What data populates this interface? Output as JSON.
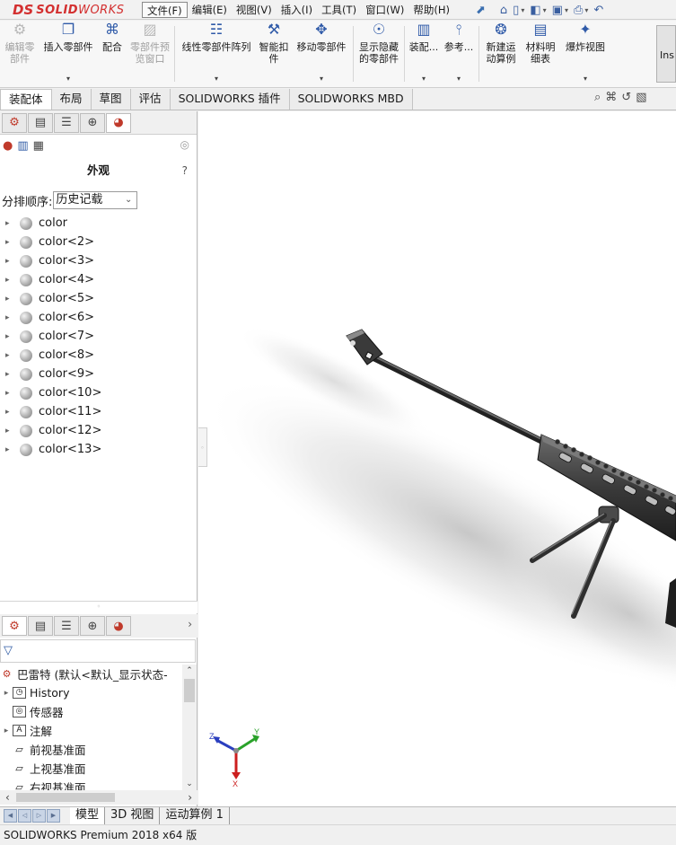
{
  "app": {
    "logo_ds": "DS",
    "logo_solid": "SOLID",
    "logo_works": "WORKS",
    "status_text": "SOLIDWORKS Premium 2018 x64 版"
  },
  "menu": [
    "文件(F)",
    "编辑(E)",
    "视图(V)",
    "插入(I)",
    "工具(T)",
    "窗口(W)",
    "帮助(H)"
  ],
  "commands": {
    "edit_part": "编辑零部件",
    "insert_part": "插入零部件",
    "mate": "配合",
    "preview_window": "零部件预览窗口",
    "linear_pattern": "线性零部件阵列",
    "smart_fastener": "智能扣件",
    "move_part": "移动零部件",
    "show_hidden": "显示隐藏的零部件",
    "assembly": "装配...",
    "reference": "参考...",
    "new_motion": "新建运动算例",
    "bom": "材料明细表",
    "explode": "爆炸视图",
    "instant3d": "Ins"
  },
  "tabs": [
    "装配体",
    "布局",
    "草图",
    "评估",
    "SOLIDWORKS 插件",
    "SOLIDWORKS MBD"
  ],
  "appearance_panel": {
    "title": "外观",
    "help": "?",
    "sort_label": "分排顺序:",
    "sort_value": "历史记载",
    "colors": [
      "color",
      "color<2>",
      "color<3>",
      "color<4>",
      "color<5>",
      "color<6>",
      "color<7>",
      "color<8>",
      "color<9>",
      "color<10>",
      "color<11>",
      "color<12>",
      "color<13>"
    ]
  },
  "feature_tree": {
    "root": "巴雷特 (默认<默认_显示状态-",
    "items": [
      {
        "label": "History",
        "expand": true
      },
      {
        "label": "传感器",
        "expand": false
      },
      {
        "label": "注解",
        "expand": true
      },
      {
        "label": "前视基准面",
        "expand": false
      },
      {
        "label": "上视基准面",
        "expand": false
      },
      {
        "label": "右视基准面",
        "expand": false
      }
    ]
  },
  "triad": {
    "x": "X",
    "y": "Y",
    "z": "Z"
  },
  "bottom_tabs": [
    "模型",
    "3D 视图",
    "运动算例 1"
  ],
  "colors": {
    "brand_red": "#d32f2f",
    "axis_x": "#cc1f1f",
    "axis_y": "#2aa22a",
    "axis_z": "#2b3fbf"
  }
}
